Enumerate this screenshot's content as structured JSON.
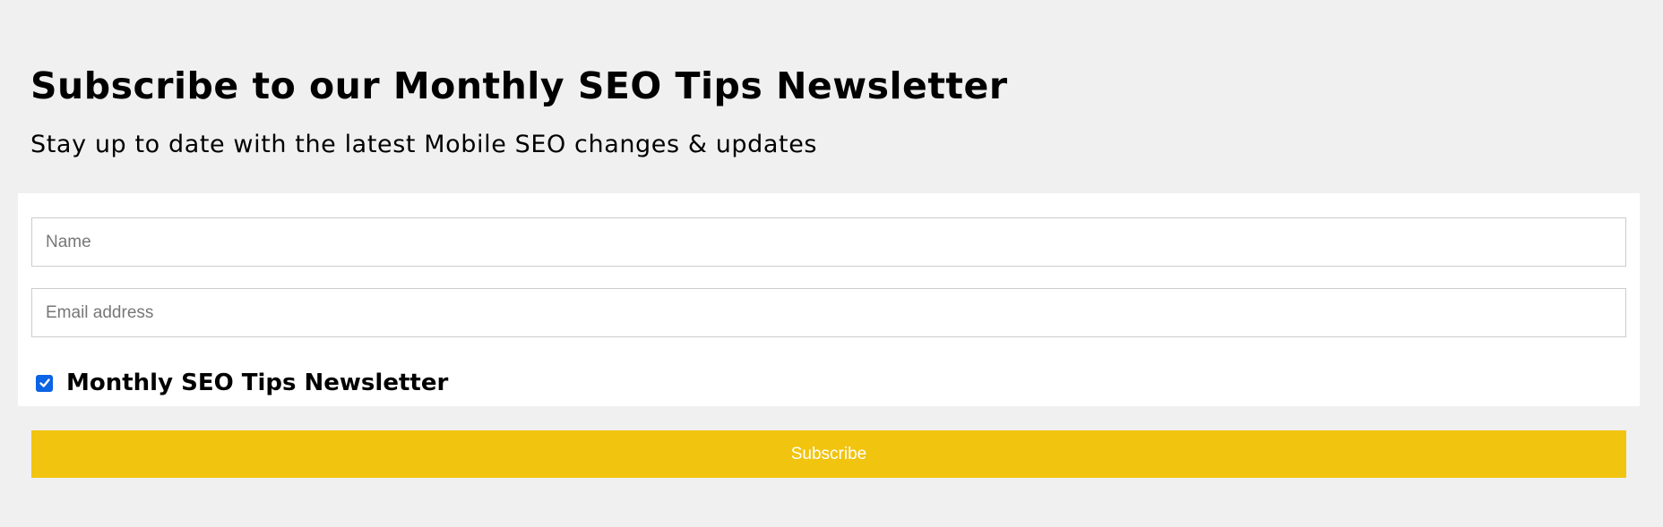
{
  "newsletter": {
    "heading": "Subscribe to our Monthly SEO Tips Newsletter",
    "subheading": "Stay up to date with the latest Mobile SEO changes & updates",
    "form": {
      "name_placeholder": "Name",
      "name_value": "",
      "email_placeholder": "Email address",
      "email_value": "",
      "list_option": {
        "label": "Monthly SEO Tips Newsletter",
        "checked": true
      },
      "submit_label": "Subscribe"
    }
  },
  "colors": {
    "page_background": "#f0f0f0",
    "card_background": "#ffffff",
    "input_border": "#cccccc",
    "checkbox_accent": "#0b63e5",
    "button_background": "#f1c40f",
    "button_text": "#ffffff",
    "heading_text": "#000000"
  },
  "icons": {
    "checkbox_state": "check-icon"
  }
}
